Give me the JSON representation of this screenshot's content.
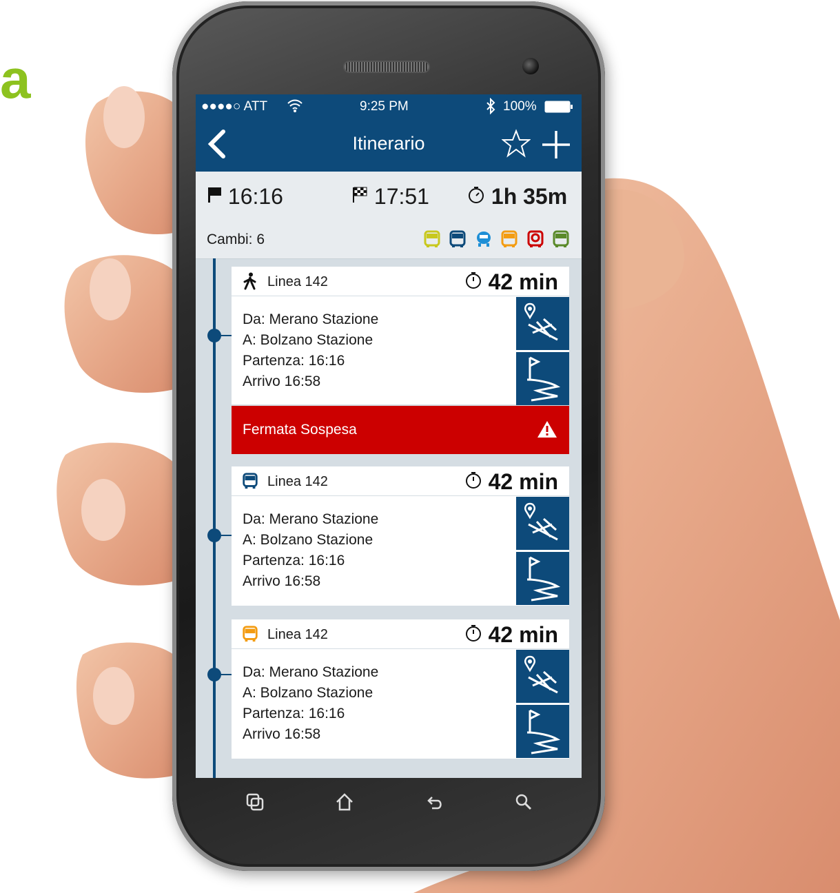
{
  "decor": {
    "corner_letter": "a"
  },
  "status_bar": {
    "carrier": "●●●●○ ATT",
    "time": "9:25 PM",
    "battery": "100%",
    "icons": [
      "wifi-icon",
      "bluetooth-icon",
      "battery-icon"
    ]
  },
  "nav": {
    "title": "Itinerario",
    "icons": [
      "back-icon",
      "star-icon",
      "plus-icon"
    ]
  },
  "summary": {
    "departure": "16:16",
    "arrival": "17:51",
    "duration": "1h 35m",
    "icons": [
      "flag-icon",
      "checkered-flag-icon",
      "stopwatch-icon"
    ]
  },
  "cambi": {
    "label": "Cambi: 6",
    "modes": [
      {
        "name": "bus-icon",
        "color": "#c8c81e"
      },
      {
        "name": "bus-icon",
        "color": "#0d4a7a"
      },
      {
        "name": "bus-icon",
        "color": "#1e8fd6"
      },
      {
        "name": "bus-icon",
        "color": "#f39c12"
      },
      {
        "name": "bus-icon",
        "color": "#cc0000"
      },
      {
        "name": "bus-icon",
        "color": "#5a8a2a"
      }
    ]
  },
  "legs": [
    {
      "mode": "walk-icon",
      "line": "Linea 142",
      "duration": "42 min",
      "from": "Da: Merano Stazione",
      "to": "A: Bolzano Stazione",
      "departure": "Partenza: 16:16",
      "arrival": "Arrivo 16:58",
      "alert": "Fermata Sospesa"
    },
    {
      "mode": "bus-icon",
      "mode_color": "#0d4a7a",
      "line": "Linea 142",
      "duration": "42 min",
      "from": "Da: Merano Stazione",
      "to": "A: Bolzano Stazione",
      "departure": "Partenza: 16:16",
      "arrival": "Arrivo 16:58"
    },
    {
      "mode": "bus-icon",
      "mode_color": "#f39c12",
      "line": "Linea 142",
      "duration": "42 min",
      "from": "Da: Merano Stazione",
      "to": "A: Bolzano Stazione",
      "departure": "Partenza: 16:16",
      "arrival": "Arrivo 16:58"
    }
  ],
  "colors": {
    "primary": "#0d4a7a",
    "alert": "#cc0000",
    "accent_green": "#8dc21f"
  },
  "softkeys": [
    "recent-apps-icon",
    "home-icon",
    "back-icon",
    "search-icon"
  ]
}
